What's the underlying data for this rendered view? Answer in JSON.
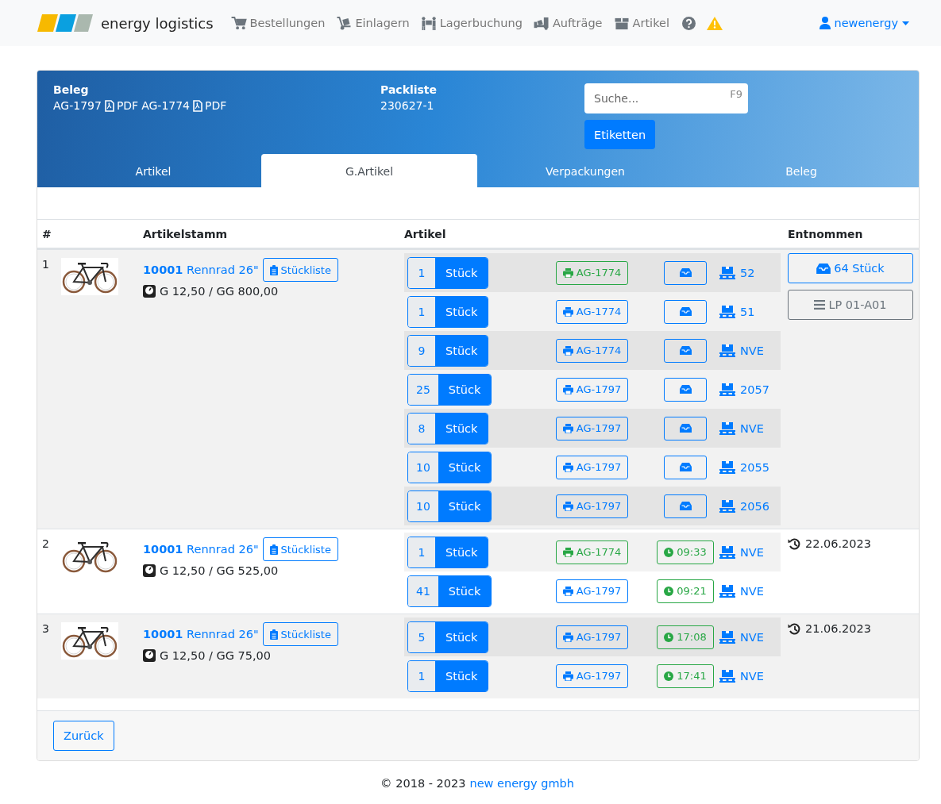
{
  "navbar": {
    "brand": "energy logistics",
    "items": [
      {
        "kind": "cart",
        "label": "Bestellungen"
      },
      {
        "kind": "dolly",
        "label": "Einlagern"
      },
      {
        "kind": "people",
        "label": "Lagerbuchung"
      },
      {
        "kind": "truck",
        "label": "Aufträge"
      },
      {
        "kind": "box",
        "label": "Artikel"
      }
    ],
    "user": "newenergy"
  },
  "header": {
    "beleg_label": "Beleg",
    "belege": [
      {
        "number": "AG-1797",
        "pdf": "PDF"
      },
      {
        "number": "AG-1774",
        "pdf": "PDF"
      }
    ],
    "packliste_label": "Packliste",
    "packliste": "230627-1",
    "search": {
      "placeholder": "Suche...",
      "shortcut": "F9"
    },
    "etiketten": "Etiketten",
    "tabs": [
      {
        "label": "Artikel",
        "selected": false
      },
      {
        "label": "G.Artikel",
        "selected": true
      },
      {
        "label": "Verpackungen",
        "selected": false
      },
      {
        "label": "Beleg",
        "selected": false
      }
    ]
  },
  "table": {
    "columns": [
      "#",
      "Artikelstamm",
      "Artikel",
      "Entnommen"
    ],
    "rows": [
      {
        "index": "1",
        "article_no": "10001",
        "name": "Rennrad 26\"",
        "stueckliste": "Stückliste",
        "weight": "G 12,50 / GG 800,00",
        "lines": [
          {
            "qty": "1",
            "unit": "Stück",
            "beleg": "AG-1774",
            "printed": true,
            "kind": "box",
            "nve": "52"
          },
          {
            "qty": "1",
            "unit": "Stück",
            "beleg": "AG-1774",
            "printed": false,
            "kind": "box",
            "nve": "51"
          },
          {
            "qty": "9",
            "unit": "Stück",
            "beleg": "AG-1774",
            "printed": false,
            "kind": "box",
            "nve": "NVE"
          },
          {
            "qty": "25",
            "unit": "Stück",
            "beleg": "AG-1797",
            "printed": false,
            "kind": "box",
            "nve": "2057"
          },
          {
            "qty": "8",
            "unit": "Stück",
            "beleg": "AG-1797",
            "printed": false,
            "kind": "box",
            "nve": "NVE"
          },
          {
            "qty": "10",
            "unit": "Stück",
            "beleg": "AG-1797",
            "printed": false,
            "kind": "box",
            "nve": "2055"
          },
          {
            "qty": "10",
            "unit": "Stück",
            "beleg": "AG-1797",
            "printed": false,
            "kind": "box",
            "nve": "2056"
          }
        ],
        "taken": {
          "kind": "buttons",
          "amount": "64 Stück",
          "location": "LP 01-A01"
        }
      },
      {
        "index": "2",
        "article_no": "10001",
        "name": "Rennrad 26\"",
        "stueckliste": "Stückliste",
        "weight": "G 12,50 / GG 525,00",
        "lines": [
          {
            "qty": "1",
            "unit": "Stück",
            "beleg": "AG-1774",
            "printed": true,
            "kind": "time",
            "time": "09:33",
            "nve": "NVE"
          },
          {
            "qty": "41",
            "unit": "Stück",
            "beleg": "AG-1797",
            "printed": false,
            "kind": "time",
            "time": "09:21",
            "nve": "NVE"
          }
        ],
        "taken": {
          "kind": "date",
          "date": "22.06.2023"
        }
      },
      {
        "index": "3",
        "article_no": "10001",
        "name": "Rennrad 26\"",
        "stueckliste": "Stückliste",
        "weight": "G 12,50 / GG 75,00",
        "lines": [
          {
            "qty": "5",
            "unit": "Stück",
            "beleg": "AG-1797",
            "printed": false,
            "kind": "time",
            "time": "17:08",
            "nve": "NVE"
          },
          {
            "qty": "1",
            "unit": "Stück",
            "beleg": "AG-1797",
            "printed": false,
            "kind": "time",
            "time": "17:41",
            "nve": "NVE"
          }
        ],
        "taken": {
          "kind": "date",
          "date": "21.06.2023"
        }
      }
    ]
  },
  "back_button": "Zurück",
  "footer": {
    "copyright": "© 2018 - 2023",
    "company": "new energy gmbh"
  }
}
